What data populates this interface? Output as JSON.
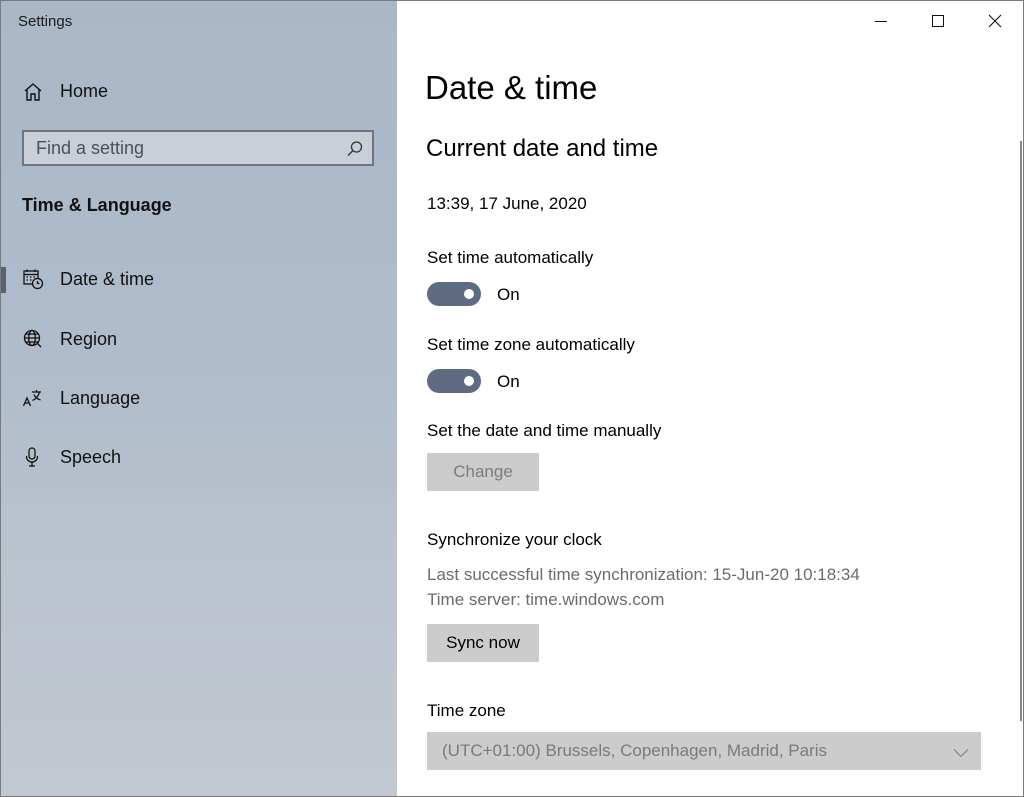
{
  "window": {
    "app_title": "Settings",
    "caption": {
      "minimize_icon": "minimize-icon",
      "maximize_icon": "maximize-icon",
      "close_icon": "close-icon"
    }
  },
  "sidebar": {
    "home": {
      "label": "Home",
      "icon": "home-icon"
    },
    "search": {
      "placeholder": "Find a setting",
      "value": "",
      "icon": "search-icon"
    },
    "section_heading": "Time & Language",
    "items": [
      {
        "label": "Date & time",
        "icon": "calendar-clock-icon",
        "selected": true
      },
      {
        "label": "Region",
        "icon": "globe-icon",
        "selected": false
      },
      {
        "label": "Language",
        "icon": "language-icon",
        "selected": false
      },
      {
        "label": "Speech",
        "icon": "microphone-icon",
        "selected": false
      }
    ]
  },
  "main": {
    "page_title": "Date & time",
    "current_section_title": "Current date and time",
    "current_datetime": "13:39, 17 June, 2020",
    "set_time_auto": {
      "label": "Set time automatically",
      "state_label": "On",
      "on": true
    },
    "set_timezone_auto": {
      "label": "Set time zone automatically",
      "state_label": "On",
      "on": true
    },
    "manual": {
      "label": "Set the date and time manually",
      "button_label": "Change",
      "disabled": true
    },
    "sync": {
      "title": "Synchronize your clock",
      "last_sync": "Last successful time synchronization: 15-Jun-20 10:18:34",
      "server": "Time server: time.windows.com",
      "button_label": "Sync now"
    },
    "time_zone": {
      "label": "Time zone",
      "selected": "(UTC+01:00) Brussels, Copenhagen, Madrid, Paris",
      "icon": "chevron-down-icon",
      "disabled": true
    }
  },
  "colors": {
    "sidebar_bg": "#b0bccb",
    "toggle_on": "#5e6b80",
    "button_bg": "#cccccc",
    "disabled_text": "#7c7c7c"
  }
}
